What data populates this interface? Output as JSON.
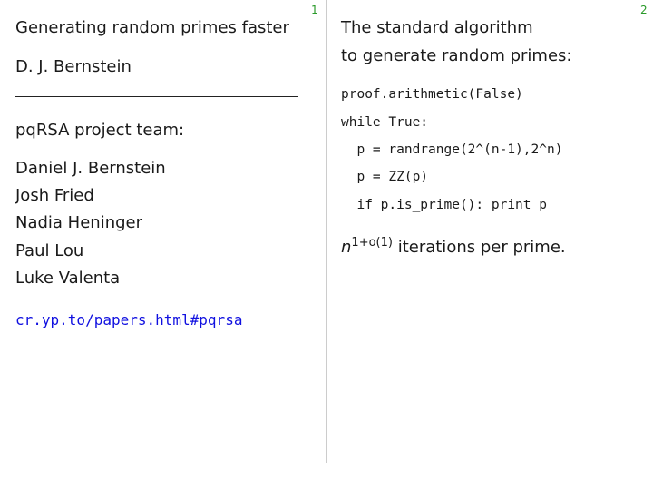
{
  "slide1": {
    "page_number": "1",
    "title": "Generating random primes faster",
    "author": "D. J. Bernstein",
    "team_heading": "pqRSA project team:",
    "members": [
      "Daniel J. Bernstein",
      "Josh Fried",
      "Nadia Heninger",
      "Paul Lou",
      "Luke Valenta"
    ],
    "link": "cr.yp.to/papers.html#pqrsa"
  },
  "slide2": {
    "page_number": "2",
    "heading1": "The standard algorithm",
    "heading2": "to generate random primes:",
    "code": [
      "proof.arithmetic(False)",
      "while True:",
      "  p = randrange(2^(n-1),2^n)",
      "  p = ZZ(p)",
      "  if p.is_prime(): print p"
    ],
    "math_base": "n",
    "math_exp": "1+o(1)",
    "math_text": " iterations per prime."
  },
  "colors": {
    "link": "#1010e0",
    "page_number": "#2a9a2a"
  }
}
